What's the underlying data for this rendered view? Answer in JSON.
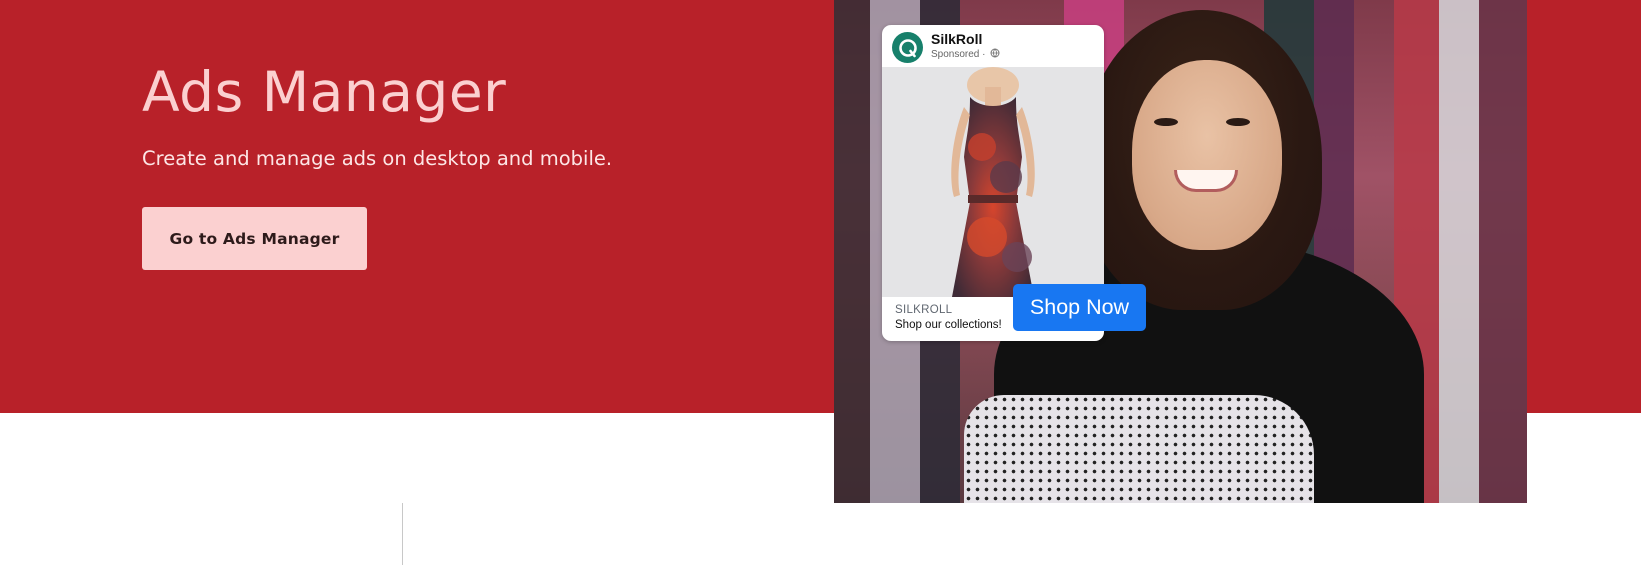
{
  "hero": {
    "title": "Ads Manager",
    "subtitle": "Create and manage ads on desktop and mobile.",
    "cta_label": "Go to Ads Manager"
  },
  "ad_preview": {
    "brand_name": "SilkRoll",
    "sponsored_label": "Sponsored ·",
    "domain": "SILKROLL",
    "tagline": "Shop our collections!",
    "cta_label": "Shop Now",
    "icons": [
      "brand-logo-icon",
      "globe-icon"
    ]
  },
  "colors": {
    "hero_background": "#b82129",
    "hero_title": "#fbd0d0",
    "cta_background": "#fbd0d0",
    "shop_button": "#1877f2"
  }
}
